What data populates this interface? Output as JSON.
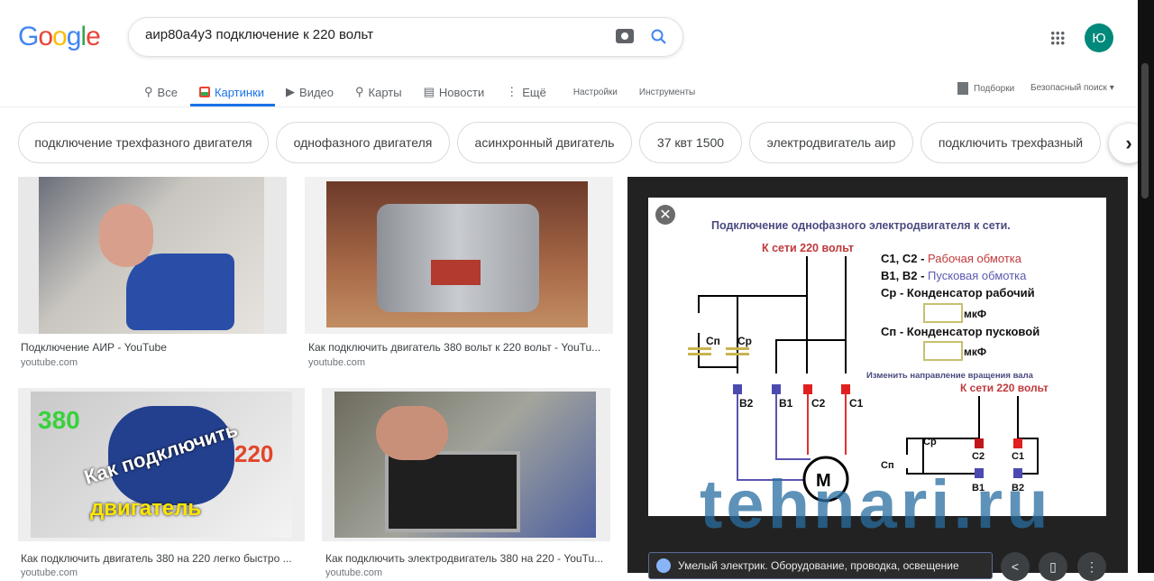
{
  "header": {
    "logo": "Google",
    "query": "аир80а4у3 подключение к 220 вольт",
    "avatar": "Ю"
  },
  "tabs": [
    {
      "label": "Все"
    },
    {
      "label": "Картинки"
    },
    {
      "label": "Видео"
    },
    {
      "label": "Карты"
    },
    {
      "label": "Новости"
    },
    {
      "label": "Ещё"
    }
  ],
  "tools": {
    "settings": "Настройки",
    "tools": "Инструменты",
    "collections": "Подборки",
    "safe_search": "Безопасный поиск"
  },
  "chips": [
    "подключение трехфазного двигателя",
    "однофазного двигателя",
    "асинхронный двигатель",
    "37 квт 1500",
    "электродвигатель аир",
    "подключить трехфазный"
  ],
  "results": [
    {
      "caption": "Подключение АИР - YouTube",
      "source": "youtube.com"
    },
    {
      "caption": "Как подключить двигатель 380 вольт к 220 вольт - YouTu...",
      "source": "youtube.com"
    },
    {
      "caption": "Как подключить двигатель 380 на 220 легко быстро ...",
      "source": "youtube.com",
      "overlay": [
        "380",
        "Как подключить",
        "220",
        "двигатель"
      ]
    },
    {
      "caption": "Как подключить электродвигатель 380 на 220 - YouTu...",
      "source": "youtube.com"
    }
  ],
  "preview": {
    "title": "Подключение однофазного электродвигателя к сети.",
    "mains": "К сети 220 вольт",
    "legend": [
      {
        "k": "С1, С2 -",
        "v": "Рабочая обмотка"
      },
      {
        "k": "В1, В2 -",
        "v": "Пусковая обмотка"
      },
      {
        "k": "Ср - Конденсатор рабочий",
        "v": ""
      },
      {
        "k": "Сп - Конденсатор пусковой",
        "v": ""
      }
    ],
    "unit": "мкФ",
    "reverse": "Изменить направление вращения вала",
    "labels": {
      "b2": "В2",
      "b1": "В1",
      "c2": "С2",
      "c1": "С1",
      "sp": "Сп",
      "sr": "Ср",
      "m": "М"
    },
    "watermark": "tehnari.ru",
    "source_title": "Умелый электрик. Оборудование, проводка, освещение"
  }
}
